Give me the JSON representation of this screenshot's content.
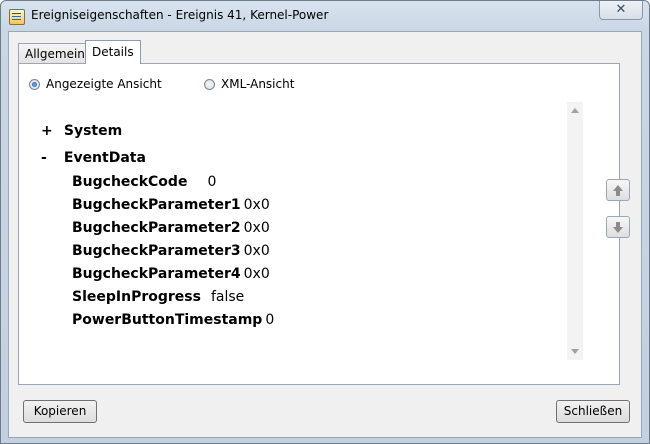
{
  "window": {
    "title": "Ereigniseigenschaften - Ereignis 41, Kernel-Power",
    "close_glyph": "✕"
  },
  "tabs": [
    {
      "label": "Allgemein",
      "active": false
    },
    {
      "label": "Details",
      "active": true
    }
  ],
  "view_options": {
    "friendly_label": "Angezeigte Ansicht",
    "friendly_checked": true,
    "xml_label": "XML-Ansicht",
    "xml_checked": false
  },
  "tree": {
    "system": {
      "toggle": "+",
      "label": "System"
    },
    "event_data": {
      "toggle": "-",
      "label": "EventData"
    },
    "fields": [
      {
        "key": "BugcheckCode",
        "value": "0"
      },
      {
        "key": "BugcheckParameter1",
        "value": "0x0"
      },
      {
        "key": "BugcheckParameter2",
        "value": "0x0"
      },
      {
        "key": "BugcheckParameter3",
        "value": "0x0"
      },
      {
        "key": "BugcheckParameter4",
        "value": "0x0"
      },
      {
        "key": "SleepInProgress",
        "value": "false"
      },
      {
        "key": "PowerButtonTimestamp",
        "value": "0"
      }
    ]
  },
  "buttons": {
    "copy": "Kopieren",
    "close": "Schließen"
  },
  "icons": {
    "app": "event-properties-icon",
    "prev": "arrow-up-icon",
    "next": "arrow-down-icon"
  }
}
